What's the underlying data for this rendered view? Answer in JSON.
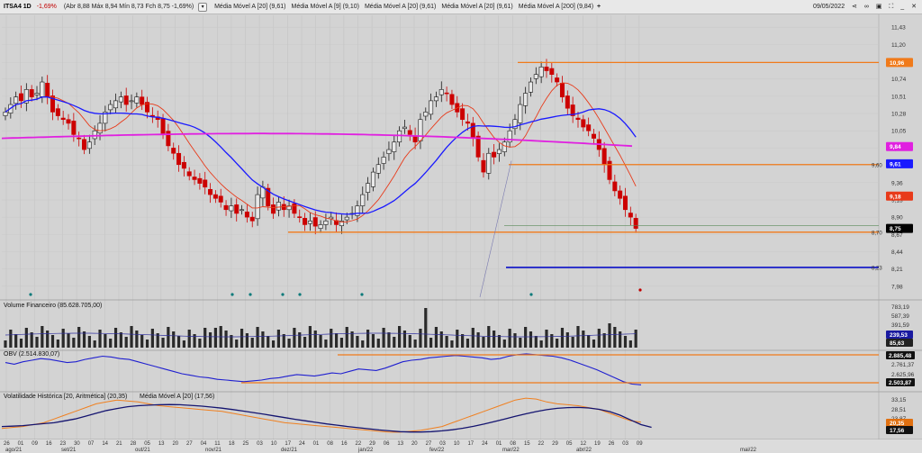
{
  "header": {
    "symbol": "ITSA4 1D",
    "change": "-1,69%",
    "ohlc": "(Abr 8,88 Máx 8,94 Mín 8,73 Fch 8,75 -1,69%)",
    "indicators": [
      "Média Móvel A [20] (9,61)",
      "Média Móvel A [9] (9,10)",
      "Média Móvel A [20] (9,61)",
      "Média Móvel A [20] (9,61)",
      "Média Móvel A [200] (9,84)"
    ],
    "date": "09/05/2022"
  },
  "colors": {
    "candle_up": "#1a1a1a",
    "candle_down": "#cc0000",
    "ma20": "#1a1aff",
    "ma9": "#e83a1a",
    "ma200": "#e020e0",
    "hline": "#f07a1a",
    "support_blue": "#0a10c8",
    "volume": "#2a2a2a",
    "obv": "#2020d0",
    "vol_hist": "#f08020"
  },
  "chart_data": [
    {
      "type": "candlestick",
      "title": "ITSA4 1D",
      "y_ticks": [
        "11,43",
        "11,20",
        "10,96",
        "10,74",
        "10,51",
        "10,28",
        "10,05",
        "9,82",
        "9,59",
        "9,36",
        "9,13",
        "8,90",
        "8,67",
        "8,44",
        "8,21",
        "7,98"
      ],
      "y_range": [
        7.93,
        11.48
      ],
      "x_tick_labels": [
        "26",
        "01",
        "09",
        "16",
        "23",
        "30",
        "07",
        "14",
        "21",
        "28",
        "05",
        "13",
        "20",
        "27",
        "04",
        "11",
        "18",
        "25",
        "03",
        "10",
        "17",
        "24",
        "01",
        "08",
        "16",
        "22",
        "29",
        "06",
        "13",
        "20",
        "27",
        "03",
        "10",
        "17",
        "24",
        "01",
        "08",
        "15",
        "22",
        "29",
        "05",
        "12",
        "19",
        "26",
        "03",
        "09"
      ],
      "month_labels": [
        "ago/21",
        "set/21",
        "out/21",
        "nov/21",
        "dez/21",
        "jan/22",
        "fev/22",
        "mar/22",
        "abr/22",
        "mai/22"
      ],
      "price_labels": [
        {
          "text": "10,96",
          "value": 10.96,
          "color": "#f07a1a"
        },
        {
          "text": "9,84",
          "value": 9.84,
          "color": "#e020e0"
        },
        {
          "text": "9,61",
          "value": 9.61,
          "color": "#1a1aff"
        },
        {
          "text": "9,18",
          "value": 9.18,
          "color": "#e83a1a"
        },
        {
          "text": "8,75",
          "value": 8.75,
          "color": "#000000"
        }
      ],
      "line_labels": [
        {
          "text": "9,60",
          "value": 9.6
        },
        {
          "text": "8,70",
          "value": 8.7
        },
        {
          "text": "8,23",
          "value": 8.23
        }
      ],
      "horizontal_lines": [
        10.96,
        9.6,
        8.7
      ],
      "support_line": 8.23,
      "closes": [
        10.3,
        10.4,
        10.5,
        10.45,
        10.6,
        10.5,
        10.55,
        10.7,
        10.5,
        10.3,
        10.25,
        10.2,
        10.15,
        10.0,
        9.95,
        9.8,
        9.9,
        10.05,
        10.15,
        10.3,
        10.4,
        10.45,
        10.5,
        10.4,
        10.45,
        10.5,
        10.4,
        10.3,
        10.25,
        10.2,
        10.0,
        9.85,
        9.75,
        9.6,
        9.55,
        9.45,
        9.4,
        9.35,
        9.3,
        9.2,
        9.15,
        9.1,
        9.0,
        9.05,
        8.95,
        9.0,
        8.9,
        8.85,
        9.2,
        9.3,
        9.05,
        8.95,
        9.1,
        9.0,
        9.05,
        8.95,
        8.9,
        8.8,
        8.85,
        8.78,
        8.8,
        8.85,
        8.9,
        8.8,
        8.85,
        8.9,
        8.95,
        9.05,
        9.2,
        9.35,
        9.5,
        9.6,
        9.7,
        9.8,
        9.9,
        10.05,
        10.1,
        10.0,
        9.9,
        10.2,
        10.3,
        10.45,
        10.5,
        10.6,
        10.55,
        10.4,
        10.3,
        10.2,
        10.15,
        9.95,
        9.7,
        9.5,
        9.75,
        9.7,
        9.8,
        9.9,
        10.05,
        10.2,
        10.4,
        10.55,
        10.7,
        10.8,
        10.9,
        10.85,
        10.8,
        10.7,
        10.5,
        10.35,
        10.25,
        10.2,
        10.1,
        10.05,
        9.95,
        9.8,
        9.6,
        9.4,
        9.25,
        9.15,
        9.0,
        8.9,
        8.75
      ],
      "volume_label": "Volume Financeiro (85.628.705,00)",
      "volume_ticks": [
        "783,19",
        "587,39",
        "391,59"
      ],
      "volume_value_labels": [
        "239,53",
        "85,63"
      ]
    },
    {
      "type": "line",
      "label": "OBV (2.514.830,07)",
      "ticks": [
        "2.885,48",
        "2.761,37",
        "2.625,96",
        "2.503,87"
      ],
      "series": [
        {
          "values": [
            2790,
            2770,
            2800,
            2820,
            2840,
            2830,
            2810,
            2790,
            2800,
            2830,
            2850,
            2870,
            2860,
            2840,
            2830,
            2800,
            2770,
            2740,
            2710,
            2680,
            2650,
            2630,
            2610,
            2600,
            2580,
            2570,
            2560,
            2550,
            2560,
            2570,
            2590,
            2600,
            2620,
            2640,
            2630,
            2620,
            2640,
            2660,
            2650,
            2680,
            2710,
            2700,
            2690,
            2720,
            2760,
            2800,
            2820,
            2830,
            2850,
            2860,
            2870,
            2880,
            2870,
            2860,
            2850,
            2830,
            2840,
            2870,
            2890,
            2900,
            2890,
            2880,
            2870,
            2850,
            2820,
            2780,
            2740,
            2700,
            2650,
            2600,
            2550,
            2520,
            2510
          ]
        }
      ]
    },
    {
      "type": "line",
      "label": "Volatilidade Histórica [20, Aritmética] (20,35)",
      "label_ma": "Média Móvel A [20] (17,56)",
      "ticks": [
        "33,15",
        "28,51",
        "23,87",
        "19,23"
      ],
      "value_labels": [
        "20,35",
        "17,56"
      ],
      "series": [
        {
          "values": [
            17,
            17.5,
            18,
            19,
            20,
            22,
            24,
            26,
            28,
            30,
            31,
            32,
            31.5,
            31,
            30,
            29,
            28.5,
            28,
            27.5,
            27,
            26.5,
            26,
            25,
            24,
            23,
            22,
            21,
            20,
            19.5,
            19,
            18.5,
            18,
            17.5,
            17,
            16.5,
            16,
            15.5,
            15,
            15,
            15.5,
            16,
            17,
            18,
            20,
            22,
            24,
            26,
            28,
            30,
            32,
            33,
            32.5,
            31,
            30,
            29.5,
            29,
            28,
            27,
            25,
            23,
            21,
            20.35
          ]
        },
        {
          "values": [
            18,
            18.2,
            18.5,
            19,
            19.5,
            20,
            21,
            22,
            23.5,
            25,
            26.5,
            27.5,
            28.5,
            29,
            29.3,
            29.5,
            29.6,
            29.5,
            29.2,
            28.8,
            28.3,
            27.7,
            27,
            26.2,
            25.4,
            24.5,
            23.6,
            22.7,
            21.8,
            21,
            20.2,
            19.4,
            18.7,
            18,
            17.4,
            16.8,
            16.2,
            15.7,
            15.3,
            15.1,
            15.1,
            15.3,
            15.7,
            16.3,
            17.1,
            18.1,
            19.3,
            20.6,
            22,
            23.4,
            24.7,
            25.9,
            26.9,
            27.6,
            28,
            28.1,
            27.8,
            27.1,
            25.9,
            24,
            21.5,
            19,
            17.56
          ]
        }
      ]
    }
  ]
}
